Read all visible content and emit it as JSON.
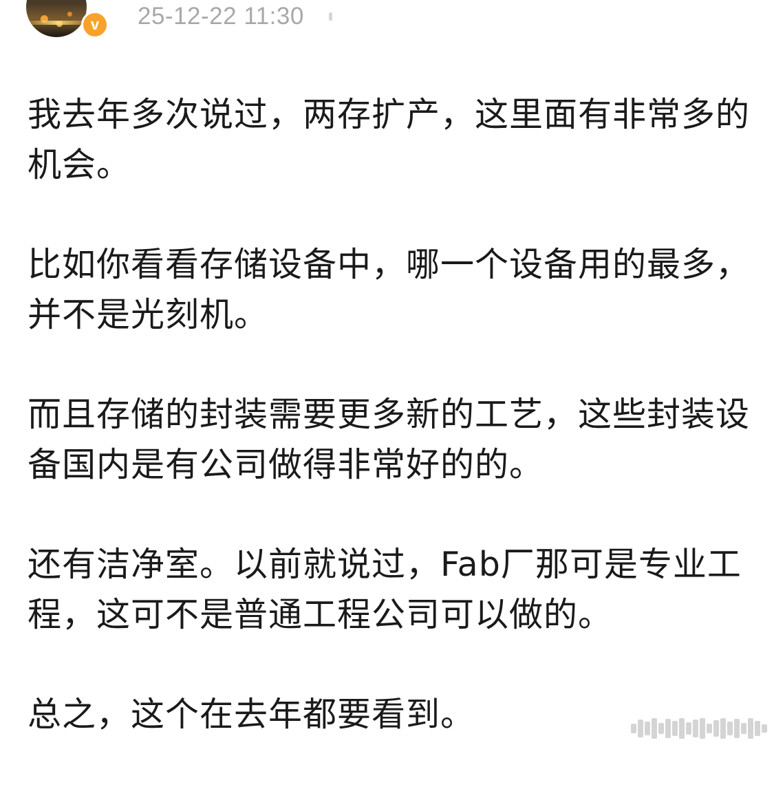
{
  "post": {
    "timestamp": "25-12-22 11:30",
    "verified_badge": "v",
    "paragraphs": [
      "我去年多次说过，两存扩产，这里面有非常多的机会。",
      "比如你看看存储设备中，哪一个设备用的最多，并不是光刻机。",
      "而且存储的封装需要更多新的工艺，这些封装设备国内是有公司做得非常好的的。",
      "还有洁净室。以前就说过，Fab厂那可是专业工程，这可不是普通工程公司可以做的。",
      "总之，这个在去年都要看到。"
    ]
  },
  "colors": {
    "text": "#1a1a1a",
    "timestamp": "#a8a8a8",
    "verified_badge": "#f7a32b",
    "background": "#ffffff"
  },
  "icons": {
    "avatar": "user-avatar-image",
    "badge": "verified-v-icon",
    "watermark": "watermark-glyph"
  }
}
